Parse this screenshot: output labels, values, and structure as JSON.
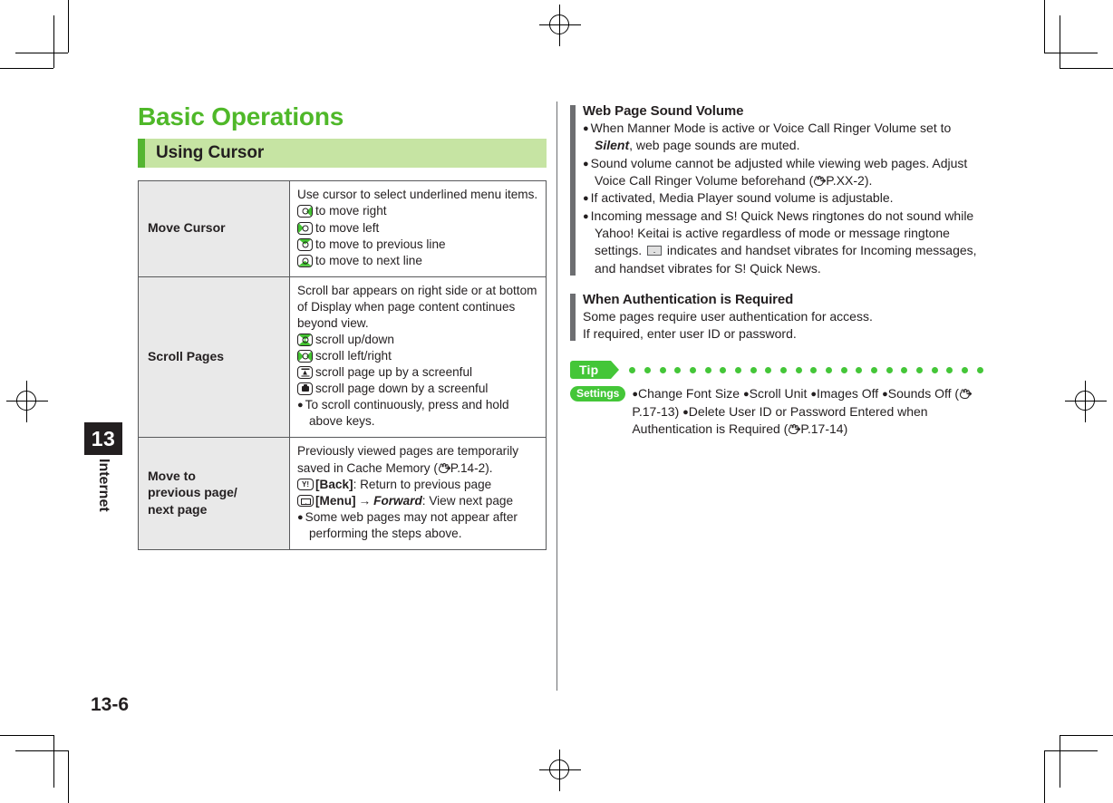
{
  "page": {
    "number": "13-6",
    "chapter_number": "13",
    "chapter_name": "Internet"
  },
  "left_column": {
    "title": "Basic Operations",
    "section_header": "Using Cursor",
    "table": {
      "rows": [
        {
          "label": "Move Cursor",
          "lines": [
            {
              "type": "text",
              "text": "Use cursor to select underlined menu items."
            },
            {
              "type": "key",
              "icon": "key-right-icon",
              "text": "to move right"
            },
            {
              "type": "key",
              "icon": "key-left-icon",
              "text": "to move left"
            },
            {
              "type": "key",
              "icon": "key-up-icon",
              "text": "to move to previous line"
            },
            {
              "type": "key",
              "icon": "key-down-icon",
              "text": "to move to next line"
            }
          ]
        },
        {
          "label": "Scroll Pages",
          "lines": [
            {
              "type": "text",
              "text": "Scroll bar appears on right side or at bottom of Display when page content continues beyond view."
            },
            {
              "type": "key",
              "icon": "key-updown-icon",
              "text": "scroll up/down"
            },
            {
              "type": "key",
              "icon": "key-leftright-icon",
              "text": "scroll left/right"
            },
            {
              "type": "key",
              "icon": "key-pageup-icon",
              "text": "scroll page up by a screenful"
            },
            {
              "type": "key",
              "icon": "key-camera-icon",
              "text": "scroll page down by a screenful"
            },
            {
              "type": "bullet",
              "text": "To scroll continuously, press and hold above keys."
            }
          ]
        },
        {
          "label": "Move to\nprevious page/\nnext page",
          "lines": [
            {
              "type": "text",
              "text": "Previously viewed pages are temporarily saved in Cache Memory (",
              "ref": "P.14-2",
              "tail": ")."
            },
            {
              "type": "softkey",
              "icon": "soft-key-yahoo-icon",
              "bold": "[Back]",
              "text": ": Return to previous page"
            },
            {
              "type": "softkey",
              "icon": "soft-key-mail-icon",
              "bold": "[Menu]",
              "arrow": "→",
              "italic": "Forward",
              "text": ": View next page"
            },
            {
              "type": "bullet",
              "text": "Some web pages may not appear after performing the steps above."
            }
          ]
        }
      ]
    }
  },
  "right_column": {
    "notes": [
      {
        "title": "Web Page Sound Volume",
        "bullets": [
          {
            "pre": "When Manner Mode is active or Voice Call Ringer Volume set to ",
            "italic": "Silent",
            "post": ", web page sounds are muted."
          },
          {
            "pre": "Sound volume cannot be adjusted while viewing web pages. Adjust Voice Call Ringer Volume beforehand (",
            "ref": "P.XX-2",
            "post": ")."
          },
          {
            "pre": "If activated, Media Player sound volume is adjustable."
          },
          {
            "pre": "Incoming message and S! Quick News ringtones do not sound while Yahoo! Keitai is active regardless of mode or message ringtone settings. ",
            "icon": "envelope-icon",
            "post": " indicates and handset vibrates for Incoming messages, and handset vibrates for S! Quick News."
          }
        ]
      },
      {
        "title": "When Authentication is Required",
        "plain": [
          "Some pages require user authentication for access.",
          "If required, enter user ID or password."
        ]
      }
    ],
    "tip": {
      "badge": "Tip",
      "settings_badge": "Settings",
      "settings_items": [
        "Change Font Size",
        "Scroll Unit",
        "Images Off",
        "Sounds Off"
      ],
      "settings_ref_1": "P.17-13",
      "settings_item_2": "Delete User ID or Password Entered when Authentication is Required",
      "settings_ref_2": "P.17-14",
      "dot_count": 24
    }
  },
  "colors": {
    "title_green": "#4fb829",
    "header_band": "#c6e4a3",
    "header_accent": "#54b531",
    "badge_green": "#44c638",
    "key_green": "#43c331",
    "label_cell": "#e9e9e9",
    "ink": "#231f20",
    "rule_gray": "#6d6e71"
  }
}
